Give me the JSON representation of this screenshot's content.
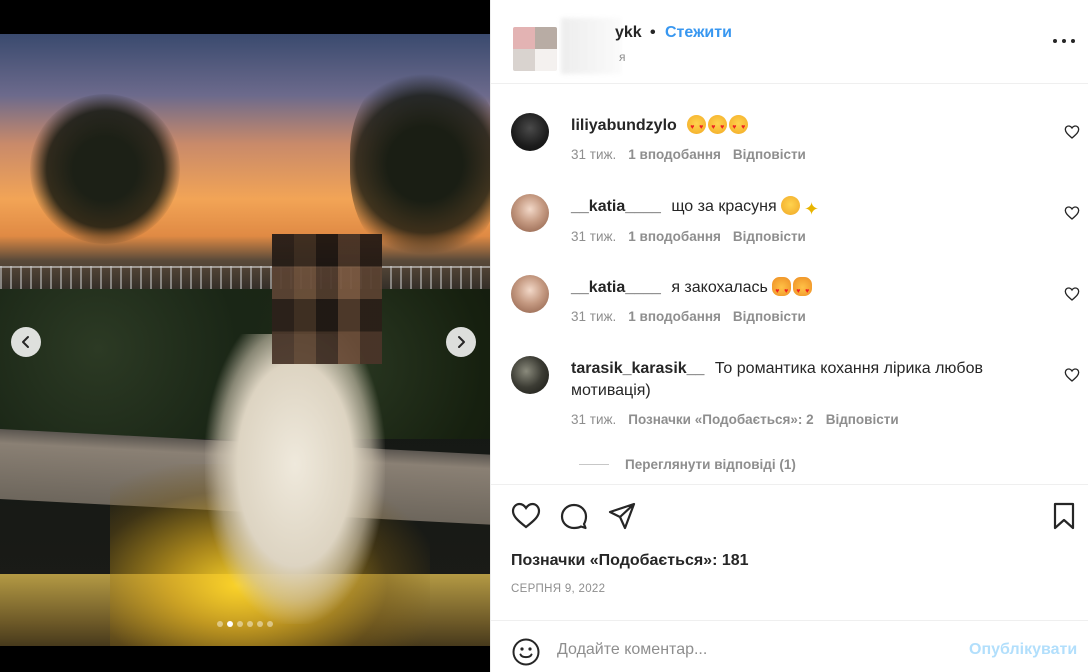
{
  "post": {
    "author": {
      "name": "ykk",
      "follow_label": "Стежити",
      "separator": "•",
      "subtitle": "я"
    },
    "media": {
      "slides_total": 6,
      "active_slide": 2
    },
    "comments": [
      {
        "username": "liliyabundzylo",
        "text": "",
        "emojis": [
          "heart-eyes",
          "heart-eyes",
          "heart-eyes"
        ],
        "time": "31 тиж.",
        "likes": "1 вподобання",
        "reply": "Відповісти"
      },
      {
        "username": "__katia____",
        "text": "що за красуня",
        "emojis": [
          "smile",
          "sparkles"
        ],
        "time": "31 тиж.",
        "likes": "1 вподобання",
        "reply": "Відповісти"
      },
      {
        "username": "__katia____",
        "text": "я закохалась",
        "emojis": [
          "heart-eyes-cat",
          "heart-eyes-cat"
        ],
        "time": "31 тиж.",
        "likes": "1 вподобання",
        "reply": "Відповісти"
      },
      {
        "username": "tarasik_karasik__",
        "text": "То романтика кохання лірика любов мотивація)",
        "emojis": [],
        "time": "31 тиж.",
        "likes": "Позначки «Подобається»: 2",
        "reply": "Відповісти"
      }
    ],
    "view_replies": "Переглянути відповіді (1)",
    "likes_total": "Позначки «Подобається»: 181",
    "date": "СЕРПНЯ 9, 2022",
    "add_comment": {
      "placeholder": "Додайте коментар...",
      "post_label": "Опублікувати"
    }
  },
  "colors": {
    "accent": "#3897f0",
    "post_disabled": "#b2dffc",
    "muted": "#8e8e8e",
    "text": "#262626"
  }
}
